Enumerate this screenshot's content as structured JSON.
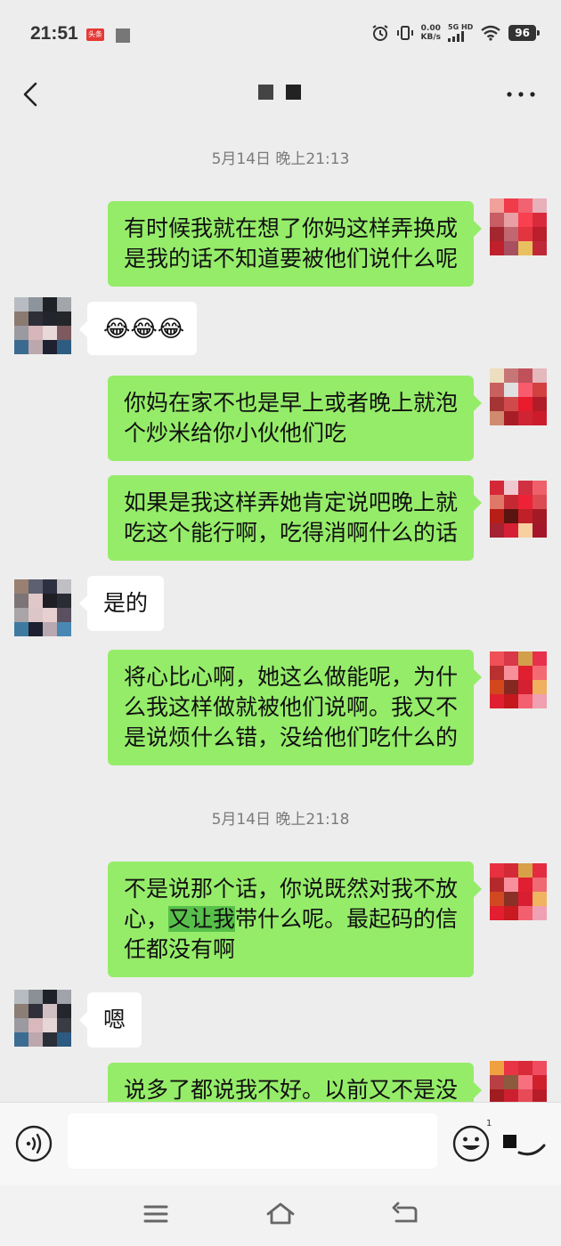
{
  "status": {
    "time": "21:51",
    "app_badge": "头条",
    "net_speed_value": "0.00",
    "net_speed_unit": "KB/s",
    "net_type_top": "5G HD",
    "net_type_bottom": "5G",
    "battery": "96"
  },
  "icons": {
    "back": "chevron-left-icon",
    "more": "more-horizontal-icon",
    "voice": "voice-icon",
    "emoji": "emoji-icon",
    "plus": "plus-icon",
    "menu": "menu-icon",
    "home": "home-icon",
    "return": "return-icon"
  },
  "colors": {
    "sent_bubble": "#95ec69",
    "received_bubble": "#ffffff",
    "background": "#ededed"
  },
  "timestamps": [
    "5月14日 晚上21:13",
    "5月14日 晚上21:18"
  ],
  "messages": [
    {
      "side": "right",
      "lines": [
        "有时候我就在想了你妈这样弄换成",
        "是我的话不知道要被他们说什么呢"
      ]
    },
    {
      "side": "left",
      "emoji": "😂😂😂"
    },
    {
      "side": "right",
      "lines": [
        "你妈在家不也是早上或者晚上就泡",
        "个炒米给你小伙他们吃"
      ]
    },
    {
      "side": "right",
      "lines": [
        "如果是我这样弄她肯定说吧晚上就",
        "吃这个能行啊，吃得消啊什么的话"
      ]
    },
    {
      "side": "left",
      "lines": [
        "是的"
      ]
    },
    {
      "side": "right",
      "lines": [
        "将心比心啊，她这么做能呢，为什",
        "么我这样做就被他们说啊。我又不",
        "是说烦什么错，没给他们吃什么的"
      ]
    },
    {
      "side": "right",
      "lines": [
        "不是说那个话，你说既然对我不放",
        "心，",
        "又让我",
        "带什么呢。最起码的信",
        "任都没有啊"
      ]
    },
    {
      "side": "left",
      "lines": [
        "嗯"
      ]
    },
    {
      "side": "right",
      "lines": [
        "说多了都说我不好。以前又不是没"
      ]
    }
  ],
  "input": {
    "placeholder": "",
    "value": "",
    "badge": "1"
  }
}
